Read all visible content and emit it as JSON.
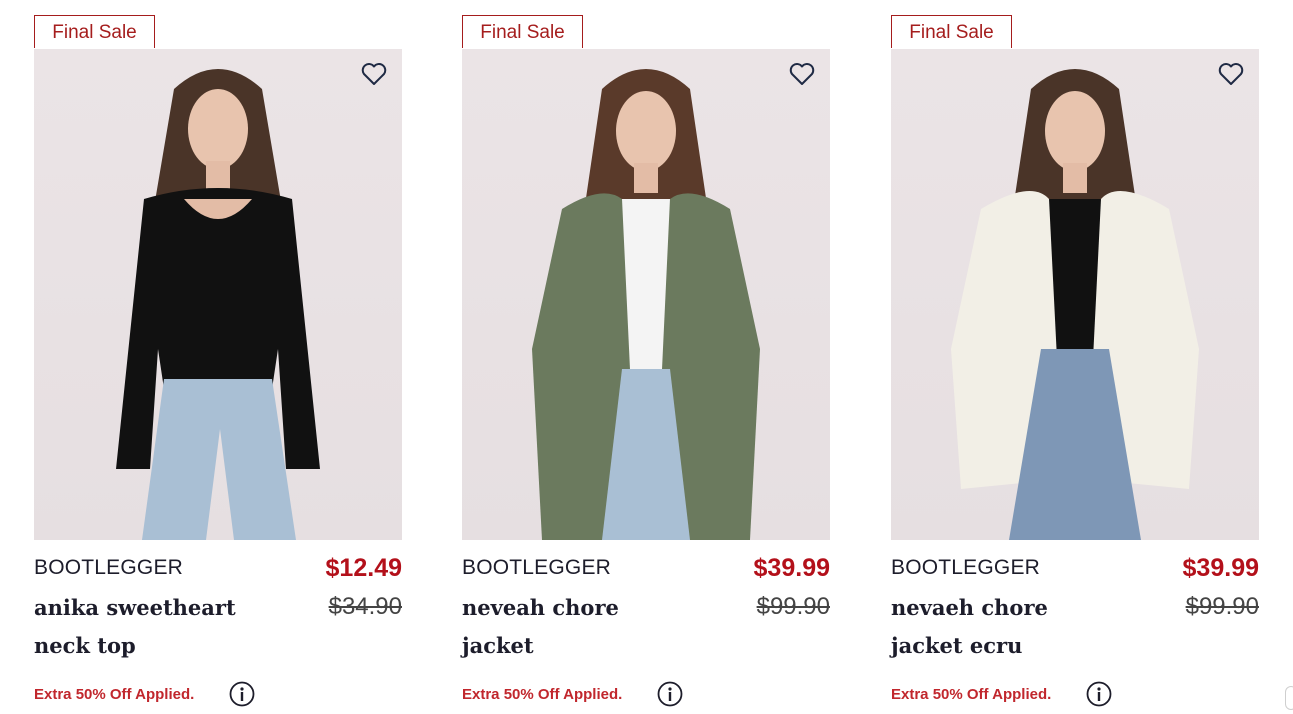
{
  "products": [
    {
      "badge": "Final Sale",
      "brand": "BOOTLEGGER",
      "name": "anika sweetheart neck top",
      "price": "$12.49",
      "original_price": "$34.90",
      "promo": "Extra 50% Off Applied.",
      "image_alt": "woman in black long-sleeve sweetheart neck top and light jeans",
      "colors": {
        "top": "#111111",
        "jeans": "#a9bfd4"
      }
    },
    {
      "badge": "Final Sale",
      "brand": "BOOTLEGGER",
      "name": "neveah chore jacket",
      "price": "$39.99",
      "original_price": "$99.90",
      "promo": "Extra 50% Off Applied.",
      "image_alt": "woman in olive green chore jacket over white top and light jeans",
      "colors": {
        "top": "#6b7a5e",
        "jeans": "#a9bfd4"
      }
    },
    {
      "badge": "Final Sale",
      "brand": "BOOTLEGGER",
      "name": "nevaeh chore jacket ecru",
      "price": "$39.99",
      "original_price": "$99.90",
      "promo": "Extra 50% Off Applied.",
      "image_alt": "woman in ecru chore jacket over black top and mid-wash jeans",
      "colors": {
        "top": "#f2efe6",
        "jeans": "#7e97b6"
      }
    }
  ],
  "icons": {
    "favorite": "heart-outline-icon",
    "info": "info-circle-icon"
  },
  "accent_color": "#a51d1d"
}
